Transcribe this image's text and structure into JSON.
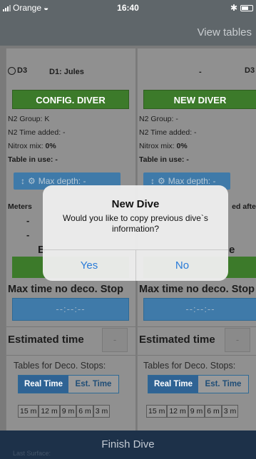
{
  "status": {
    "carrier": "Orange",
    "time": "16:40"
  },
  "nav": {
    "right_button": "View tables"
  },
  "left": {
    "group_label": "D3",
    "diver_label": "D1: Jules",
    "action_button": "CONFIG. DIVER",
    "n2_group": "N2 Group:  K",
    "n2_time": "N2 Time added: -",
    "nitrox_label": "Nitrox mix: ",
    "nitrox_value": "0%",
    "table_label": "Table in use: -",
    "max_depth": "Max depth: -",
    "meters_label": "Meters",
    "dash1": "-",
    "dash2": "-",
    "partial_letter": "B",
    "maxtime_label": "Max time no deco. Stop",
    "time_value": "--:--:--",
    "estimated_label": "Estimated time",
    "est_btn": "-",
    "tables_label": "Tables for Deco. Stops:",
    "seg_real": "Real Time",
    "seg_est": "Est. Time",
    "deco_cells": [
      "15 m",
      "12 m",
      "9 m",
      "6 m",
      "3 m"
    ]
  },
  "right": {
    "diver_label": "-",
    "group_label": "D3",
    "action_button": "NEW DIVER",
    "n2_group": "N2 Group:  -",
    "n2_time": "N2 Time added: -",
    "nitrox_label": "Nitrox mix: ",
    "nitrox_value": "0%",
    "table_label": "Table in use: -",
    "max_depth": "Max depth: -",
    "partial_right": "ed afte",
    "partial_letter": "e",
    "maxtime_label": "Max time no deco. Stop",
    "time_value": "--:--:--",
    "estimated_label": "Estimated time",
    "est_btn": "-",
    "tables_label": "Tables for Deco. Stops:",
    "seg_real": "Real Time",
    "seg_est": "Est. Time",
    "deco_cells": [
      "15 m",
      "12 m",
      "9 m",
      "6 m",
      "3 m"
    ]
  },
  "footer": {
    "finish": "Finish Dive",
    "under": "Last Surface:"
  },
  "alert": {
    "title": "New Dive",
    "message": "Would you like to copy previous dive`s information?",
    "yes": "Yes",
    "no": "No"
  },
  "colors": {
    "nav": "#5f666a",
    "green": "#3c7a2a",
    "blue": "#3f7aa9",
    "footer": "#1d3149",
    "alert_button": "#2a7bd8"
  }
}
